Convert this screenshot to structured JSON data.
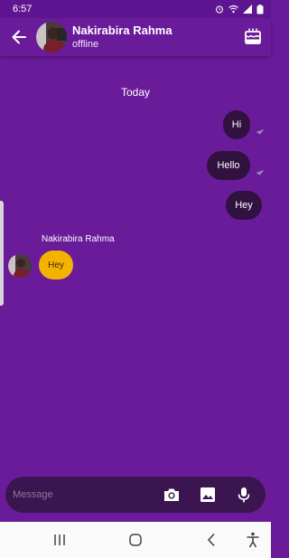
{
  "status_bar": {
    "time": "6:57",
    "icons": [
      "alarm-icon",
      "wifi-icon",
      "signal-icon",
      "battery-icon"
    ]
  },
  "header": {
    "contact_name": "Nakirabira Rahma",
    "contact_status": "offline",
    "back_icon": "arrow-back-icon",
    "action_icon": "cake-icon"
  },
  "chat": {
    "date_divider": "Today",
    "outgoing": [
      {
        "text": "Hi"
      },
      {
        "text": "Hello"
      },
      {
        "text": "Hey"
      }
    ],
    "incoming": {
      "sender": "Nakirabira Rahma",
      "text": "Hey"
    }
  },
  "composer": {
    "placeholder": "Message",
    "icons": [
      "camera-icon",
      "image-icon",
      "mic-icon"
    ]
  },
  "colors": {
    "background": "#6a1b9a",
    "outgoing_bubble": "#311140",
    "incoming_bubble": "#f5b301",
    "composer": "#3a1550"
  },
  "system_nav": {
    "icons": [
      "recent-apps-icon",
      "home-icon",
      "back-icon",
      "accessibility-icon"
    ]
  }
}
